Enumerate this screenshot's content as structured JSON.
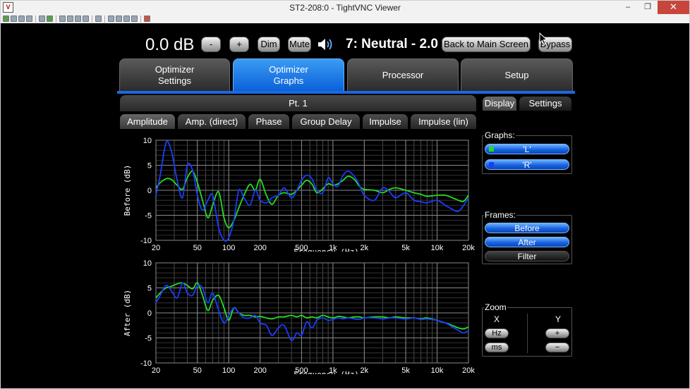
{
  "window": {
    "title": "ST2-208:0 - TightVNC Viewer",
    "minimize": "–",
    "restore": "❐",
    "close": "✕"
  },
  "top": {
    "volume": "0.0 dB",
    "minus_label": "-",
    "plus_label": "+",
    "dim_label": "Dim",
    "mute_label": "Mute",
    "preset": "7: Neutral - 2.0",
    "back_label": "Back to Main Screen",
    "bypass_label": "Bypass"
  },
  "main_tabs": [
    {
      "line1": "Optimizer",
      "line2": "Settings"
    },
    {
      "line1": "Optimizer",
      "line2": "Graphs"
    },
    {
      "line1": "Processor",
      "line2": ""
    },
    {
      "line1": "Setup",
      "line2": ""
    }
  ],
  "point_title": "Pt. 1",
  "graph_tabs": [
    "Amplitude",
    "Amp. (direct)",
    "Phase",
    "Group Delay",
    "Impulse",
    "Impulse (lin)"
  ],
  "right_tabs": [
    "Display",
    "Settings"
  ],
  "panel": {
    "graphs_label": "Graphs:",
    "graphs": [
      {
        "label": "'L'",
        "color": "#22dd22"
      },
      {
        "label": "'R'",
        "color": "#1a3cff"
      }
    ],
    "frames_label": "Frames:",
    "frames": [
      "Before",
      "After",
      "Filter"
    ],
    "zoom_label": "Zoom",
    "zoom_x_label": "X",
    "zoom_y_label": "Y",
    "zoom_hz_label": "Hz",
    "zoom_ms_label": "ms",
    "zoom_plus_label": "+",
    "zoom_minus_label": "−"
  },
  "chart_data": [
    {
      "type": "line",
      "ylabel": "Before (dB)",
      "xlabel": "Frequency (Hz)",
      "xscale": "log",
      "xlim": [
        20,
        20000
      ],
      "ylim": [
        -10,
        10
      ],
      "x_ticks": [
        "20",
        "50",
        "100",
        "200",
        "500",
        "1k",
        "2k",
        "5k",
        "10k",
        "20k"
      ],
      "y_ticks": [
        "10",
        "5",
        "0",
        "-5",
        "-10"
      ],
      "series": [
        {
          "name": "L",
          "color": "#22dd22",
          "x": [
            20,
            22,
            25,
            28,
            32,
            36,
            40,
            45,
            50,
            56,
            63,
            70,
            80,
            90,
            100,
            112,
            125,
            140,
            160,
            180,
            200,
            230,
            260,
            300,
            340,
            400,
            450,
            500,
            560,
            630,
            700,
            800,
            900,
            1000,
            1120,
            1250,
            1400,
            1600,
            1800,
            2000,
            2500,
            3000,
            3500,
            4000,
            5000,
            6000,
            7000,
            8000,
            10000,
            12000,
            14000,
            16000,
            18000,
            20000
          ],
          "y": [
            0.5,
            1.5,
            2.3,
            2.2,
            1.0,
            0.2,
            2.5,
            3.8,
            1.5,
            -2.0,
            -5.5,
            -3.0,
            -0.3,
            -5.5,
            -7.5,
            -6.0,
            -3.5,
            -1.0,
            1.2,
            0.0,
            2.2,
            -1.0,
            -2.8,
            -1.0,
            -0.5,
            -0.8,
            0.0,
            1.0,
            2.0,
            1.2,
            -0.5,
            0.3,
            1.3,
            1.0,
            1.3,
            2.0,
            2.8,
            2.2,
            0.8,
            0.2,
            0.0,
            -0.5,
            0.2,
            0.5,
            0.0,
            -0.5,
            -0.8,
            -1.2,
            -1.0,
            -1.0,
            -1.5,
            -2.0,
            -2.2,
            -1.0
          ]
        },
        {
          "name": "R",
          "color": "#1a3cff",
          "x": [
            20,
            22,
            25,
            28,
            32,
            36,
            40,
            45,
            50,
            56,
            63,
            70,
            80,
            90,
            100,
            112,
            125,
            140,
            160,
            180,
            200,
            230,
            260,
            300,
            340,
            400,
            450,
            500,
            560,
            630,
            700,
            800,
            900,
            1000,
            1120,
            1250,
            1400,
            1600,
            1800,
            2000,
            2500,
            3000,
            3500,
            4000,
            5000,
            6000,
            7000,
            8000,
            10000,
            12000,
            14000,
            16000,
            18000,
            20000
          ],
          "y": [
            -1.0,
            3.0,
            9.5,
            8.0,
            2.0,
            -1.5,
            5.0,
            4.0,
            -1.0,
            -4.0,
            -2.0,
            -1.0,
            -7.5,
            -10.0,
            -9.5,
            -6.0,
            0.0,
            -1.5,
            -3.0,
            0.0,
            -2.0,
            -2.5,
            -1.5,
            -1.0,
            0.5,
            -1.5,
            0.0,
            2.0,
            3.0,
            2.3,
            0.0,
            -0.5,
            2.5,
            1.3,
            0.8,
            3.0,
            3.8,
            2.8,
            1.0,
            -1.0,
            -2.0,
            0.5,
            -0.3,
            -1.5,
            -0.5,
            -2.0,
            -2.3,
            -2.5,
            -2.0,
            -3.0,
            -3.8,
            -4.2,
            -3.0,
            -1.5
          ]
        }
      ]
    },
    {
      "type": "line",
      "ylabel": "After (dB)",
      "xlabel": "Frequency (Hz)",
      "xscale": "log",
      "xlim": [
        20,
        20000
      ],
      "ylim": [
        -10,
        10
      ],
      "x_ticks": [
        "20",
        "50",
        "100",
        "200",
        "500",
        "1k",
        "2k",
        "5k",
        "10k",
        "20k"
      ],
      "y_ticks": [
        "10",
        "5",
        "0",
        "-5",
        "-10"
      ],
      "series": [
        {
          "name": "L",
          "color": "#22dd22",
          "x": [
            20,
            22,
            25,
            28,
            32,
            36,
            40,
            45,
            50,
            56,
            63,
            70,
            80,
            90,
            100,
            112,
            125,
            140,
            160,
            180,
            200,
            230,
            260,
            300,
            340,
            400,
            450,
            500,
            560,
            630,
            700,
            800,
            900,
            1000,
            1120,
            1250,
            1400,
            1600,
            1800,
            2000,
            2500,
            3000,
            3500,
            4000,
            5000,
            6000,
            7000,
            8000,
            10000,
            12000,
            14000,
            16000,
            18000,
            20000
          ],
          "y": [
            3.0,
            4.0,
            5.0,
            5.3,
            5.8,
            6.0,
            5.5,
            4.8,
            6.0,
            3.5,
            0.5,
            2.5,
            3.5,
            1.0,
            -1.5,
            1.0,
            0.0,
            -0.5,
            -0.5,
            -0.8,
            -0.7,
            -1.0,
            -1.2,
            -0.8,
            -0.8,
            -0.5,
            -0.8,
            -0.5,
            -1.0,
            -0.8,
            -1.0,
            -0.5,
            -0.8,
            -1.0,
            -0.7,
            -0.8,
            -1.0,
            -0.8,
            -0.8,
            -1.0,
            -0.8,
            -0.8,
            -1.0,
            -0.8,
            -1.0,
            -1.0,
            -1.2,
            -1.0,
            -1.5,
            -2.0,
            -2.5,
            -3.0,
            -3.2,
            -2.8
          ]
        },
        {
          "name": "R",
          "color": "#1a3cff",
          "x": [
            20,
            22,
            25,
            28,
            32,
            36,
            40,
            45,
            50,
            56,
            63,
            70,
            80,
            90,
            100,
            112,
            125,
            140,
            160,
            180,
            200,
            230,
            260,
            300,
            340,
            400,
            450,
            500,
            560,
            630,
            700,
            800,
            900,
            1000,
            1120,
            1250,
            1400,
            1600,
            1800,
            2000,
            2500,
            3000,
            3500,
            4000,
            5000,
            6000,
            7000,
            8000,
            10000,
            12000,
            14000,
            16000,
            18000,
            20000
          ],
          "y": [
            2.0,
            3.5,
            5.5,
            4.5,
            3.0,
            6.0,
            4.0,
            3.5,
            5.5,
            5.0,
            2.0,
            4.0,
            0.5,
            -2.0,
            -0.5,
            1.0,
            0.0,
            -1.0,
            -1.0,
            -0.5,
            -2.0,
            -2.5,
            -4.5,
            -3.0,
            -2.5,
            -5.5,
            -4.0,
            -4.5,
            -1.8,
            -3.0,
            -1.5,
            -1.0,
            -1.5,
            -1.3,
            -1.0,
            -1.2,
            -1.0,
            -1.2,
            -1.3,
            -1.0,
            -1.0,
            -1.2,
            -1.0,
            -1.0,
            -1.2,
            -1.0,
            -1.3,
            -1.2,
            -1.5,
            -2.0,
            -2.8,
            -3.5,
            -4.0,
            -3.5
          ]
        }
      ]
    }
  ]
}
